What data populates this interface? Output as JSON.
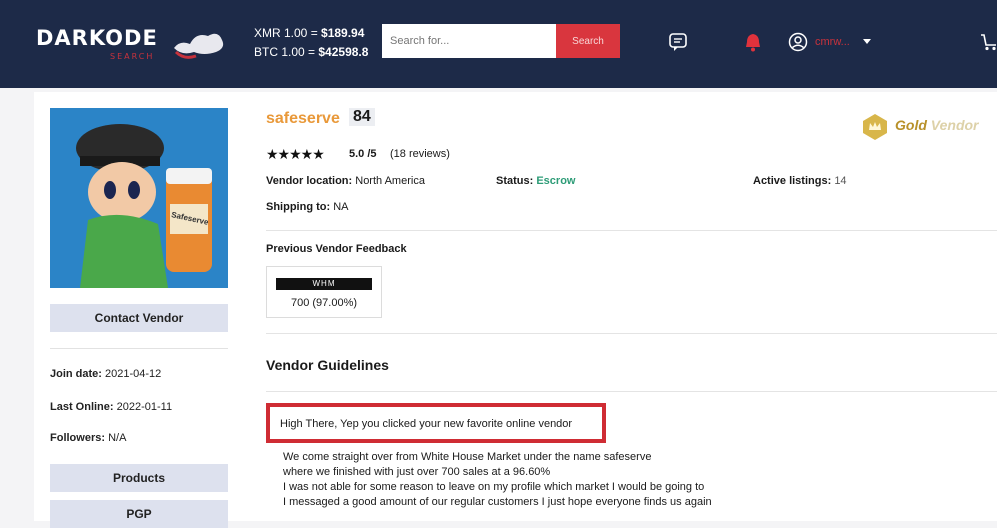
{
  "header": {
    "logo_text": "DARKODE",
    "logo_subtext": "SEARCH",
    "xmr_label": "XMR 1.00 = ",
    "xmr_value": "$189.94",
    "btc_label": "BTC 1.00 = ",
    "btc_value": "$42598.8",
    "search_placeholder": "Search for...",
    "search_button": "Search",
    "user_name": "cmrw...",
    "icons": [
      "chat-icon",
      "bell-icon",
      "user-icon",
      "chevron-down-icon",
      "cart-icon"
    ]
  },
  "vendor": {
    "name": "safeserve",
    "score": "84",
    "badge_prefix": "Gold",
    "badge_suffix": "Vendor",
    "stars": "★★★★★",
    "rating": "5.0 /5",
    "reviews": "(18 reviews)",
    "location_label": "Vendor location:",
    "location_value": "North America",
    "status_label": "Status:",
    "status_value": "Escrow",
    "listings_label": "Active listings:",
    "listings_value": "14",
    "shipping_label": "Shipping to:",
    "shipping_value": "NA",
    "feedback_title": "Previous Vendor Feedback",
    "feedback_market": "WHM",
    "feedback_value": "700 (97.00%)",
    "guidelines_title": "Vendor Guidelines",
    "highlight_text": "High There, Yep you clicked your new favorite online vendor",
    "paragraph": [
      "We come straight over from White House Market under the name safeserve",
      "where we finished with just over 700 sales at a 96.60%",
      "I was not able for some reason to leave on my profile which market I would be going to",
      "I messaged a good amount of our regular customers I just hope everyone finds us again"
    ]
  },
  "sidebar": {
    "contact_button": "Contact Vendor",
    "join_label": "Join date:",
    "join_value": "2021-04-12",
    "last_online_label": "Last Online:",
    "last_online_value": "2022-01-11",
    "followers_label": "Followers:",
    "followers_value": "N/A",
    "products_button": "Products",
    "pgp_button": "PGP",
    "avatar_label": "Safeserve"
  },
  "colors": {
    "header_bg": "#1d2a48",
    "accent_red": "#d9363e",
    "vendor_name": "#e9993a",
    "escrow_green": "#2d9c77",
    "gold": "#b8912a"
  }
}
